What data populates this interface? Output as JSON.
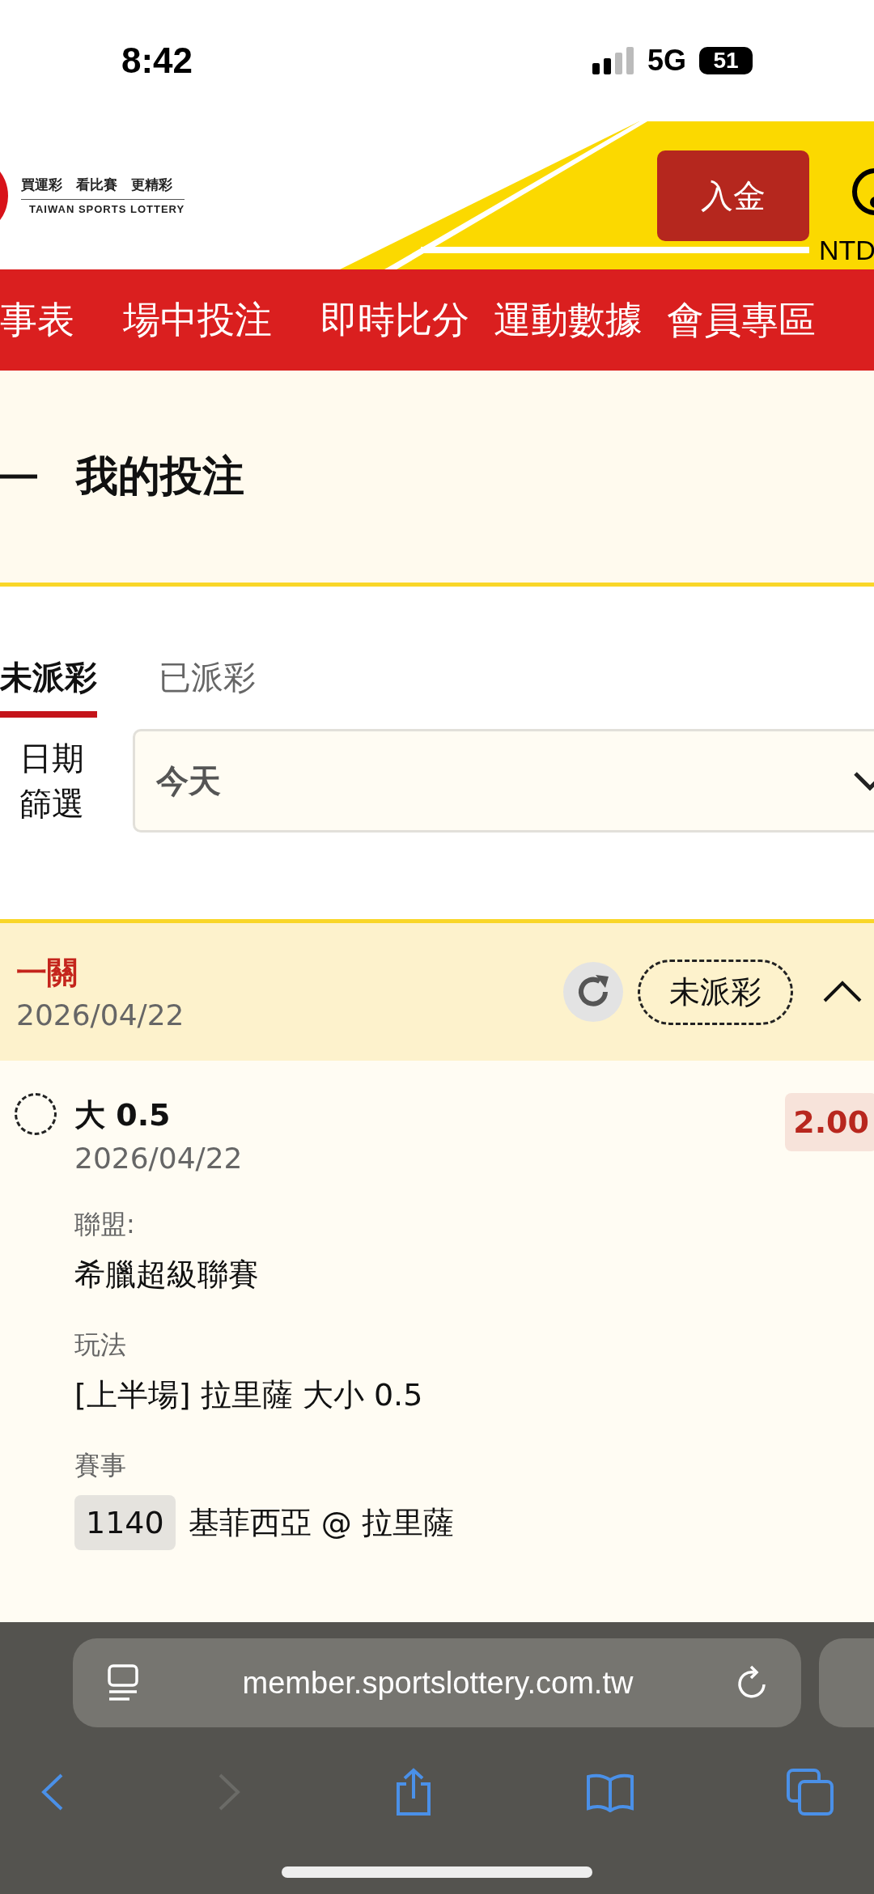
{
  "status_bar": {
    "time": "8:42",
    "network": "5G",
    "battery": "51"
  },
  "header": {
    "tagline": "買運彩　看比賽　更精彩",
    "brand": "TAIWAN SPORTS LOTTERY",
    "deposit_button": "入金",
    "balance_label": "NTD"
  },
  "nav": [
    {
      "label": "事表"
    },
    {
      "label": "場中投注"
    },
    {
      "label": "即時比分"
    },
    {
      "label": "運動數據"
    },
    {
      "label": "會員專區"
    }
  ],
  "page_title": "我的投注",
  "tabs": [
    {
      "label": "未派彩",
      "selected": true
    },
    {
      "label": "已派彩",
      "selected": false
    }
  ],
  "date_filter": {
    "label": "日期篩選",
    "value": "今天"
  },
  "bet": {
    "type": "一關",
    "date": "2026/04/22",
    "status": "未派彩",
    "expanded": true,
    "selections": [
      {
        "pick": "大 0.5",
        "odds": "2.00",
        "date": "2026/04/22",
        "fields": [
          {
            "label": "聯盟:",
            "value": "希臘超級聯賽"
          },
          {
            "label": "玩法",
            "value": "[上半場] 拉里薩 大小 0.5"
          },
          {
            "label": "賽事",
            "code": "1140",
            "value": "基菲西亞 @ 拉里薩"
          }
        ]
      }
    ]
  },
  "browser": {
    "url": "member.sportslottery.com.tw"
  }
}
